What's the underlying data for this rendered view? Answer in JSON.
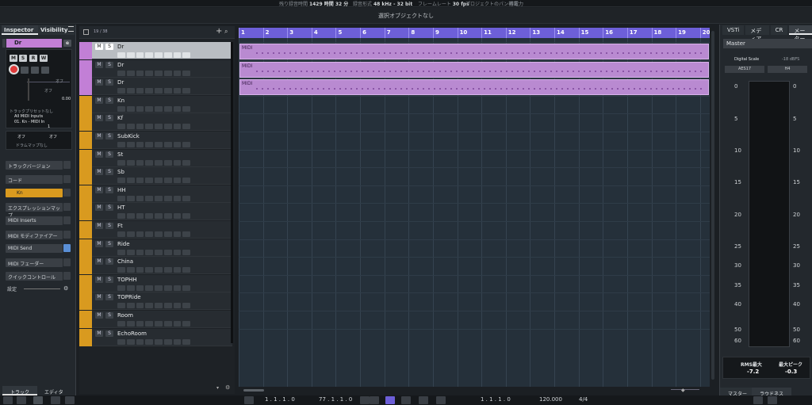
{
  "topbar": {
    "status": [
      {
        "label": "残り録音時間",
        "value": "1429 時間 32 分"
      },
      {
        "label": "録音形式",
        "value": "48 kHz - 32 bit"
      },
      {
        "label": "フレームレート",
        "value": "30 fps"
      },
      {
        "label": "プロジェクトのパン補正",
        "value": ""
      },
      {
        "label": "",
        "value": "等電力"
      }
    ]
  },
  "infoline": "選択オブジェクトなし",
  "inspector": {
    "tabs": [
      "Inspector",
      "Visibility"
    ],
    "track_name": "Dr",
    "btn_labels": [
      "M",
      "S",
      "R",
      "W"
    ],
    "vol_val": "0.00",
    "pan_val": "オフ",
    "pan_val2": "オフ",
    "preset": "トラックプリセットなし",
    "input": "All MIDI Inputs",
    "output": "01. Kn - MIDI In",
    "channel": "1",
    "bank": "オフ",
    "prog": "オフ",
    "drummap": "ドラムマップなし",
    "sections": [
      {
        "label": "トラックバージョン",
        "name": "track-version-section"
      },
      {
        "label": "コード",
        "name": "chord-section"
      },
      {
        "label": "Kn",
        "name": "instrument-kn-section"
      },
      {
        "label": "エクスプレッションマップ",
        "name": "expression-map-section"
      },
      {
        "label": "MIDI Inserts",
        "name": "midi-inserts-section"
      },
      {
        "label": "MIDI モディファイアー",
        "name": "midi-modifiers-section"
      },
      {
        "label": "MIDI Send",
        "name": "midi-send-section"
      },
      {
        "label": "MIDI フェーダー",
        "name": "midi-fader-section"
      },
      {
        "label": "クイックコントロール",
        "name": "quick-controls-section"
      }
    ],
    "settings": "設定",
    "bottom_tabs": [
      "トラック",
      "エディター"
    ]
  },
  "tracklist": {
    "count": "19 / 38",
    "tracks": [
      {
        "name": "Dr",
        "color": "#c27fd6",
        "selected": true
      },
      {
        "name": "Dr",
        "color": "#c27fd6"
      },
      {
        "name": "Dr",
        "color": "#c27fd6"
      },
      {
        "name": "Kn",
        "color": "#d99a1f"
      },
      {
        "name": "Kf",
        "color": "#d99a1f"
      },
      {
        "name": "SubKick",
        "color": "#d99a1f"
      },
      {
        "name": "St",
        "color": "#d99a1f"
      },
      {
        "name": "Sb",
        "color": "#d99a1f"
      },
      {
        "name": "HH",
        "color": "#d99a1f"
      },
      {
        "name": "HT",
        "color": "#d99a1f"
      },
      {
        "name": "Ft",
        "color": "#d99a1f"
      },
      {
        "name": "Ride",
        "color": "#d99a1f"
      },
      {
        "name": "China",
        "color": "#d99a1f"
      },
      {
        "name": "TOPHH",
        "color": "#d99a1f"
      },
      {
        "name": "TOPRide",
        "color": "#d99a1f"
      },
      {
        "name": "Room",
        "color": "#d99a1f"
      },
      {
        "name": "EchoRoom",
        "color": "#d99a1f"
      }
    ]
  },
  "ruler": {
    "bars": [
      "1",
      "2",
      "3",
      "4",
      "5",
      "6",
      "7",
      "8",
      "9",
      "10",
      "11",
      "12",
      "13",
      "14",
      "15",
      "16",
      "17",
      "18",
      "19",
      "20"
    ]
  },
  "parts": [
    {
      "label": "MIDI"
    },
    {
      "label": "MIDI"
    },
    {
      "label": "MIDI"
    }
  ],
  "meter": {
    "tabs": [
      "VSTi",
      "メディア",
      "CR",
      "メーター"
    ],
    "title": "Master",
    "scale_name": "Digital Scale",
    "scale_db": "-18 dBFS",
    "aes": "AES17",
    "hold": "H4",
    "scale": [
      "0",
      "5",
      "10",
      "15",
      "20",
      "25",
      "30",
      "35",
      "40",
      "50",
      "60"
    ],
    "rms_label": "RMS最大",
    "rms_val": "-7.2",
    "peak_label": "最大ピーク",
    "peak_val": "-0.3",
    "bottom_tabs": [
      "マスター",
      "ラウドネス"
    ]
  },
  "transport": {
    "pos_left": "1 . 1 . 1 . 0",
    "pos_right": "77 . 1 . 1 . 0",
    "main_pos": "1 . 1 . 1 . 0",
    "tempo": "120.000",
    "signature": "4/4"
  }
}
